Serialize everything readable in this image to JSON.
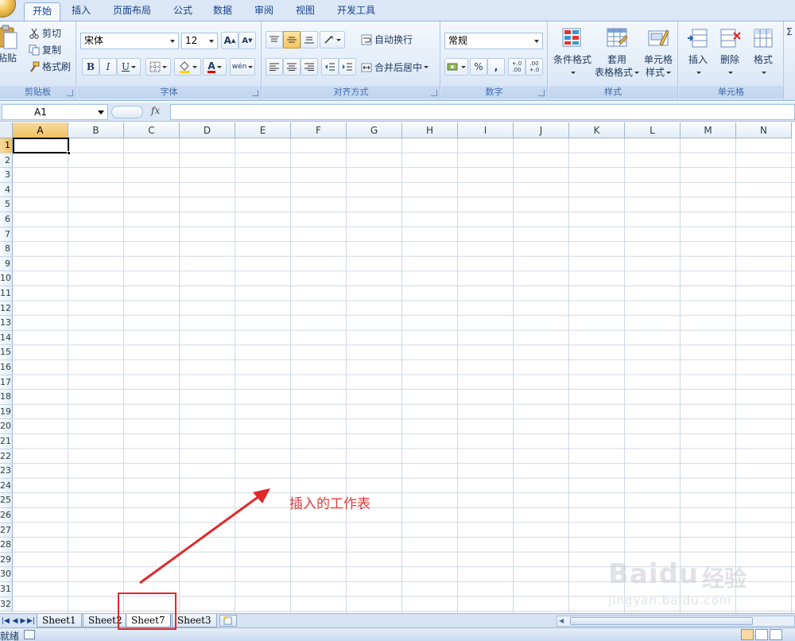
{
  "tabs": [
    "开始",
    "插入",
    "页面布局",
    "公式",
    "数据",
    "审阅",
    "视图",
    "开发工具"
  ],
  "active_tab": 0,
  "ribbon": {
    "clipboard": {
      "label": "剪贴板",
      "paste": "粘贴",
      "cut": "剪切",
      "copy": "复制",
      "format_painter": "格式刷"
    },
    "font": {
      "label": "字体",
      "font_name": "宋体",
      "font_size": "12",
      "bold": "B",
      "italic": "I",
      "underline": "U",
      "grow": "A",
      "shrink": "A",
      "font_color": "A",
      "phonetic": "wén"
    },
    "alignment": {
      "label": "对齐方式",
      "wrap_text": "自动换行",
      "merge_center": "合并后居中"
    },
    "number": {
      "label": "数字",
      "format": "常规",
      "percent": "%",
      "comma": ",",
      "inc_decimal": "+.0 .00",
      "dec_decimal": ".00 +.0"
    },
    "styles": {
      "label": "样式",
      "conditional": "条件格式",
      "table_format_1": "套用",
      "table_format_2": "表格格式",
      "cell_styles_1": "单元格",
      "cell_styles_2": "样式"
    },
    "cells": {
      "label": "单元格",
      "insert": "插入",
      "delete": "删除",
      "format": "格式"
    }
  },
  "formula_bar": {
    "name_box": "A1",
    "fx": "fx",
    "value": ""
  },
  "grid": {
    "columns": [
      "A",
      "B",
      "C",
      "D",
      "E",
      "F",
      "G",
      "H",
      "I",
      "J",
      "K",
      "L",
      "M",
      "N"
    ],
    "rows": [
      "1",
      "2",
      "3",
      "4",
      "5",
      "6",
      "7",
      "8",
      "9",
      "10",
      "11",
      "12",
      "13",
      "14",
      "15",
      "16",
      "17",
      "18",
      "19",
      "20",
      "21",
      "22",
      "23",
      "24",
      "25",
      "26",
      "27",
      "28",
      "29",
      "30",
      "31",
      "32"
    ],
    "active_cell": "A1"
  },
  "annotation": {
    "text": "插入的工作表",
    "color": "#e23b3b"
  },
  "watermark": {
    "brand": "Baidu",
    "cn": "经验",
    "url": "jingyan.baidu.com"
  },
  "sheets": [
    "Sheet1",
    "Sheet2",
    "Sheet7",
    "Sheet3"
  ],
  "active_sheet": 2,
  "status": {
    "text": "就绪"
  },
  "colors": {
    "accent": "#15428b",
    "ribbon_bg": "#dbe7f6",
    "highlight": "#e0292b"
  }
}
